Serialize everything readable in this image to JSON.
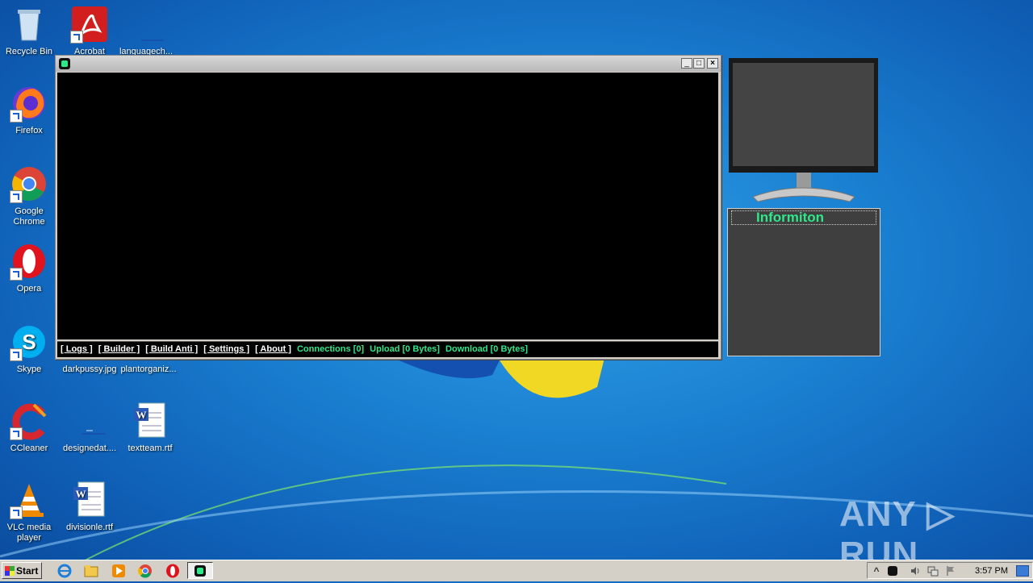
{
  "desktop": {
    "icons": [
      {
        "label": "Recycle Bin"
      },
      {
        "label": "Acrobat"
      },
      {
        "label": "languagech..."
      },
      {
        "label": "Firefox"
      },
      {
        "label": "Google Chrome"
      },
      {
        "label": "Opera"
      },
      {
        "label": "Skype"
      },
      {
        "label": "darkpussy.jpg"
      },
      {
        "label": "plantorganiz..."
      },
      {
        "label": "CCleaner"
      },
      {
        "label": "designedat...."
      },
      {
        "label": "textteam.rtf"
      },
      {
        "label": "VLC media player"
      },
      {
        "label": "divisionle.rtf"
      }
    ]
  },
  "window": {
    "menu": [
      "[ Logs ]",
      "[ Builder ]",
      "[ Build Anti ]",
      "[ Settings ]",
      "[ About ]"
    ],
    "stats": {
      "connections": "Connections [0]",
      "upload": "Upload [0 Bytes]",
      "download": "Download [0 Bytes]"
    },
    "buttons": {
      "minimize": "_",
      "maximize": "□",
      "close": "×"
    }
  },
  "info_panel": {
    "title": "Informiton"
  },
  "taskbar": {
    "start_label": "Start",
    "clock": "3:57 PM",
    "tray_arrow": "^"
  },
  "watermark": "ANY ▷ RUN",
  "colors": {
    "accent_green": "#2ee88a",
    "console_bg": "#000000",
    "panel_bg": "#3f3f3f"
  }
}
